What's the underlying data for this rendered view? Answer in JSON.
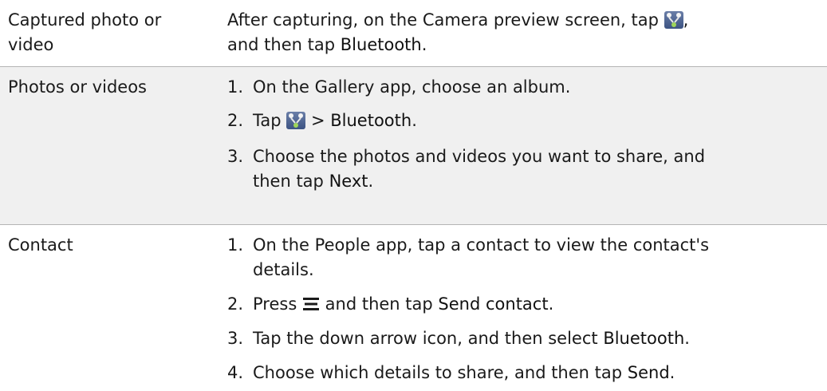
{
  "rows": [
    {
      "label_line1": "Captured photo or",
      "label_line2": "video",
      "desc_part1": "After capturing, on the Camera preview screen, tap",
      "desc_part2": ",",
      "desc_line2_part1": "and then tap",
      "desc_line2_bold": "Bluetooth",
      "desc_line2_part2": "."
    },
    {
      "label": "Photos or videos",
      "steps": [
        {
          "num": "1.",
          "text": "On the Gallery app, choose an album."
        },
        {
          "num": "2.",
          "text_pre": "Tap",
          "text_mid": ">",
          "text_bold": "Bluetooth",
          "text_post": "."
        },
        {
          "num": "3.",
          "line1": "Choose the photos and videos you want to share, and",
          "line2_pre": "then tap",
          "line2_bold": "Next",
          "line2_post": "."
        }
      ]
    },
    {
      "label": "Contact",
      "steps": [
        {
          "num": "1.",
          "line1": "On the People app, tap a contact to view the contact's",
          "line2": "details."
        },
        {
          "num": "2.",
          "text_pre": "Press",
          "text_mid": "and then tap",
          "text_bold": "Send contact",
          "text_post": "."
        },
        {
          "num": "3.",
          "text_pre": "Tap the down arrow icon, and then select",
          "text_bold": "Bluetooth",
          "text_post": "."
        },
        {
          "num": "4.",
          "text_pre": "Choose which details to share, and then tap",
          "text_bold": "Send",
          "text_post": "."
        }
      ]
    }
  ],
  "icons": {
    "share": "share-icon",
    "menu": "menu-icon"
  }
}
